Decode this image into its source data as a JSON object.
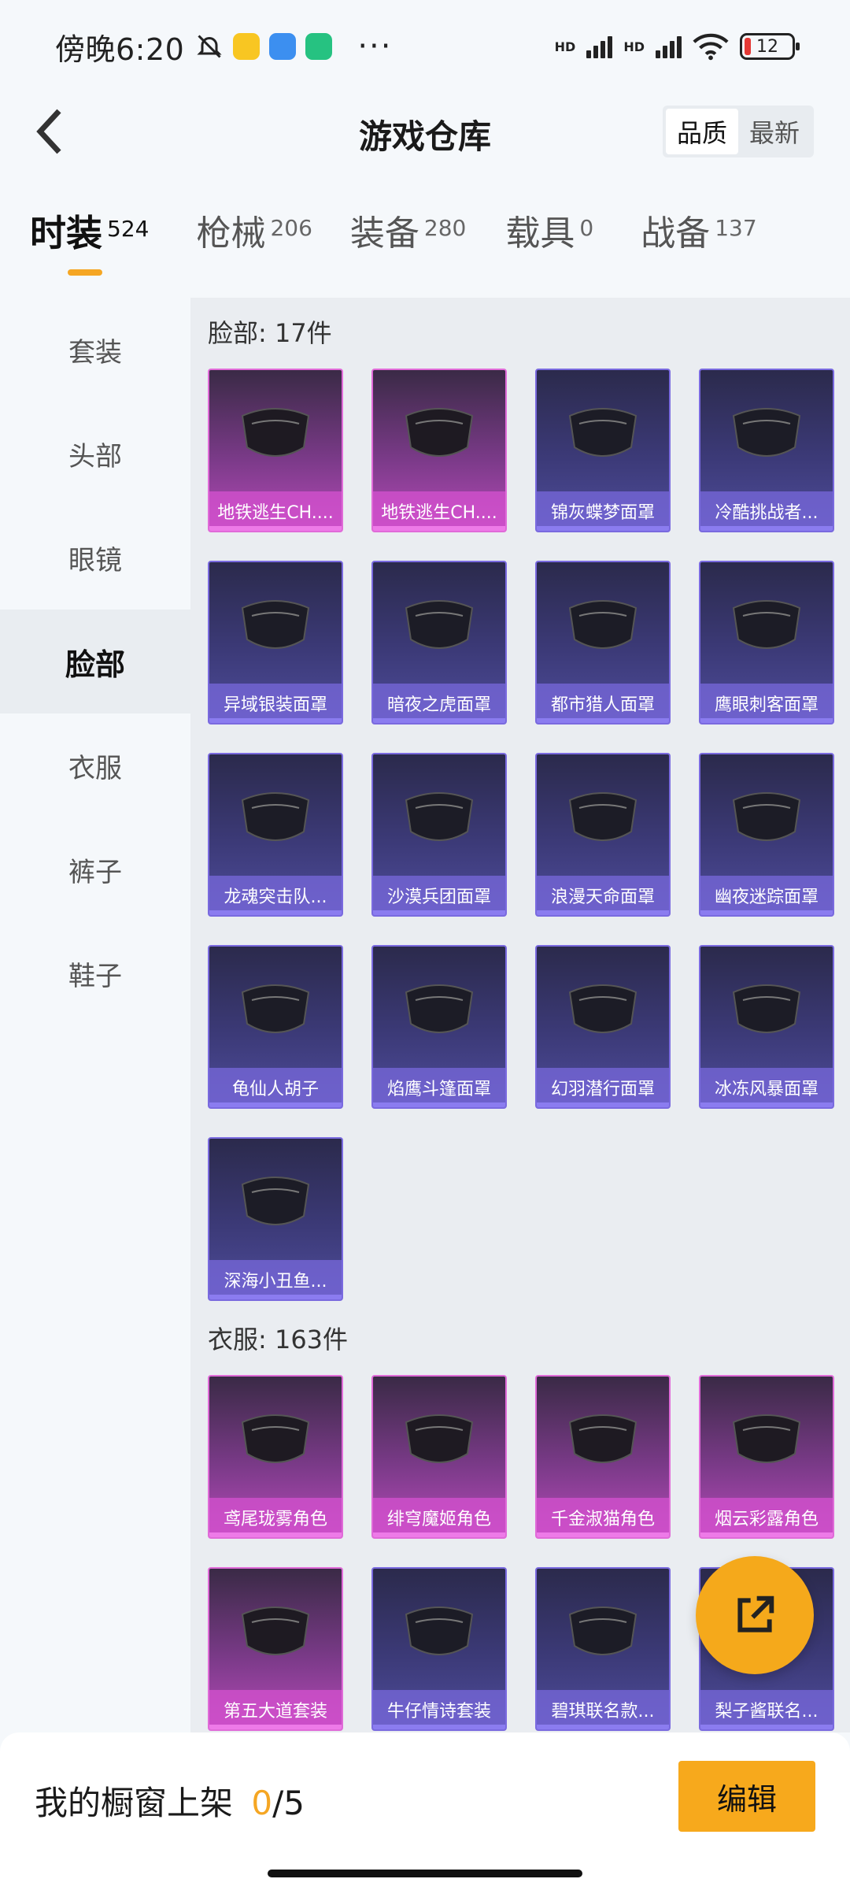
{
  "status_bar": {
    "time": "傍晚6:20",
    "dots": "···",
    "signal_label_1": "HD",
    "signal_label_2": "HD",
    "battery": "12"
  },
  "header": {
    "title": "游戏仓库",
    "sort_options": [
      "品质",
      "最新"
    ],
    "sort_selected": "品质"
  },
  "category_tabs": [
    {
      "label": "时装",
      "count": "524"
    },
    {
      "label": "枪械",
      "count": "206"
    },
    {
      "label": "装备",
      "count": "280"
    },
    {
      "label": "载具",
      "count": "0"
    },
    {
      "label": "战备",
      "count": "137"
    }
  ],
  "sidebar": {
    "items": [
      "套装",
      "头部",
      "眼镜",
      "脸部",
      "衣服",
      "裤子",
      "鞋子"
    ],
    "selected": "脸部"
  },
  "sections": [
    {
      "title": "脸部: 17件",
      "items": [
        {
          "name": "地铁逃生CH....",
          "rarity": "pink",
          "icon": "black-face-mask"
        },
        {
          "name": "地铁逃生CH....",
          "rarity": "pink",
          "icon": "black-mask-pieces"
        },
        {
          "name": "锦灰蝶梦面罩",
          "rarity": "purple",
          "icon": "chain-mask"
        },
        {
          "name": "冷酷挑战者...",
          "rarity": "purple",
          "icon": "goggles-helmet-mask"
        },
        {
          "name": "异域银装面罩",
          "rarity": "purple",
          "icon": "silver-face-mask"
        },
        {
          "name": "暗夜之虎面罩",
          "rarity": "purple",
          "icon": "dark-respirator"
        },
        {
          "name": "都市猎人面罩",
          "rarity": "purple",
          "icon": "bandana-mask"
        },
        {
          "name": "鹰眼刺客面罩",
          "rarity": "purple",
          "icon": "plague-doctor-mask"
        },
        {
          "name": "龙魂突击队...",
          "rarity": "purple",
          "icon": "red-trim-respirator"
        },
        {
          "name": "沙漠兵团面罩",
          "rarity": "purple",
          "icon": "camo-face-mask"
        },
        {
          "name": "浪漫天命面罩",
          "rarity": "purple",
          "icon": "pink-blue-masks"
        },
        {
          "name": "幽夜迷踪面罩",
          "rarity": "purple",
          "icon": "black-cloth-mask"
        },
        {
          "name": "龟仙人胡子",
          "rarity": "purple",
          "icon": "white-beard"
        },
        {
          "name": "焰鹰斗篷面罩",
          "rarity": "purple",
          "icon": "black-gold-mask"
        },
        {
          "name": "幻羽潜行面罩",
          "rarity": "purple",
          "icon": "black-mask"
        },
        {
          "name": "冰冻风暴面罩",
          "rarity": "purple",
          "icon": "green-scarf"
        },
        {
          "name": "深海小丑鱼...",
          "rarity": "purple",
          "icon": "snorkel-goggles"
        }
      ]
    },
    {
      "title": "衣服: 163件",
      "items": [
        {
          "name": "鸢尾珑雾角色",
          "rarity": "pink",
          "icon": "white-dress-character"
        },
        {
          "name": "绯穹魔姬角色",
          "rarity": "pink",
          "icon": "red-hair-character"
        },
        {
          "name": "千金淑猫角色",
          "rarity": "pink",
          "icon": "white-cat-character"
        },
        {
          "name": "烟云彩露角色",
          "rarity": "pink",
          "icon": "pink-gown-character"
        },
        {
          "name": "第五大道套装",
          "rarity": "pink",
          "icon": "outfit-set"
        },
        {
          "name": "牛仔情诗套装",
          "rarity": "purple",
          "icon": "denim-outfit-set"
        },
        {
          "name": "碧琪联名款...",
          "rarity": "purple",
          "icon": "pink-hair-character"
        },
        {
          "name": "梨子酱联名...",
          "rarity": "purple",
          "icon": "character"
        }
      ]
    }
  ],
  "bottom_bar": {
    "label": "我的橱窗上架",
    "current": "0",
    "total": "/5",
    "edit_label": "编辑"
  },
  "colors": {
    "accent": "#f5a623",
    "pink_rarity": "#e06bd8",
    "purple_rarity": "#7a6adf"
  }
}
